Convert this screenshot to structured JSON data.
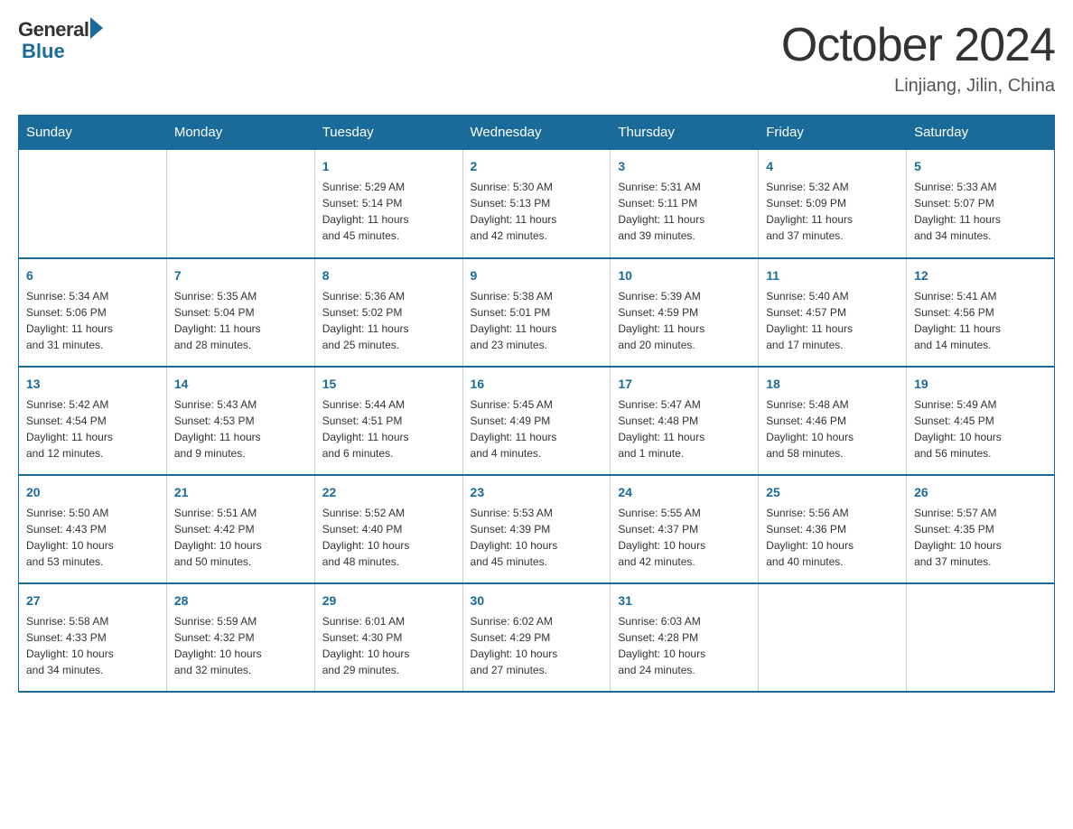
{
  "logo": {
    "general": "General",
    "blue": "Blue"
  },
  "title": "October 2024",
  "location": "Linjiang, Jilin, China",
  "days_of_week": [
    "Sunday",
    "Monday",
    "Tuesday",
    "Wednesday",
    "Thursday",
    "Friday",
    "Saturday"
  ],
  "weeks": [
    [
      {
        "day": "",
        "info": ""
      },
      {
        "day": "",
        "info": ""
      },
      {
        "day": "1",
        "info": "Sunrise: 5:29 AM\nSunset: 5:14 PM\nDaylight: 11 hours\nand 45 minutes."
      },
      {
        "day": "2",
        "info": "Sunrise: 5:30 AM\nSunset: 5:13 PM\nDaylight: 11 hours\nand 42 minutes."
      },
      {
        "day": "3",
        "info": "Sunrise: 5:31 AM\nSunset: 5:11 PM\nDaylight: 11 hours\nand 39 minutes."
      },
      {
        "day": "4",
        "info": "Sunrise: 5:32 AM\nSunset: 5:09 PM\nDaylight: 11 hours\nand 37 minutes."
      },
      {
        "day": "5",
        "info": "Sunrise: 5:33 AM\nSunset: 5:07 PM\nDaylight: 11 hours\nand 34 minutes."
      }
    ],
    [
      {
        "day": "6",
        "info": "Sunrise: 5:34 AM\nSunset: 5:06 PM\nDaylight: 11 hours\nand 31 minutes."
      },
      {
        "day": "7",
        "info": "Sunrise: 5:35 AM\nSunset: 5:04 PM\nDaylight: 11 hours\nand 28 minutes."
      },
      {
        "day": "8",
        "info": "Sunrise: 5:36 AM\nSunset: 5:02 PM\nDaylight: 11 hours\nand 25 minutes."
      },
      {
        "day": "9",
        "info": "Sunrise: 5:38 AM\nSunset: 5:01 PM\nDaylight: 11 hours\nand 23 minutes."
      },
      {
        "day": "10",
        "info": "Sunrise: 5:39 AM\nSunset: 4:59 PM\nDaylight: 11 hours\nand 20 minutes."
      },
      {
        "day": "11",
        "info": "Sunrise: 5:40 AM\nSunset: 4:57 PM\nDaylight: 11 hours\nand 17 minutes."
      },
      {
        "day": "12",
        "info": "Sunrise: 5:41 AM\nSunset: 4:56 PM\nDaylight: 11 hours\nand 14 minutes."
      }
    ],
    [
      {
        "day": "13",
        "info": "Sunrise: 5:42 AM\nSunset: 4:54 PM\nDaylight: 11 hours\nand 12 minutes."
      },
      {
        "day": "14",
        "info": "Sunrise: 5:43 AM\nSunset: 4:53 PM\nDaylight: 11 hours\nand 9 minutes."
      },
      {
        "day": "15",
        "info": "Sunrise: 5:44 AM\nSunset: 4:51 PM\nDaylight: 11 hours\nand 6 minutes."
      },
      {
        "day": "16",
        "info": "Sunrise: 5:45 AM\nSunset: 4:49 PM\nDaylight: 11 hours\nand 4 minutes."
      },
      {
        "day": "17",
        "info": "Sunrise: 5:47 AM\nSunset: 4:48 PM\nDaylight: 11 hours\nand 1 minute."
      },
      {
        "day": "18",
        "info": "Sunrise: 5:48 AM\nSunset: 4:46 PM\nDaylight: 10 hours\nand 58 minutes."
      },
      {
        "day": "19",
        "info": "Sunrise: 5:49 AM\nSunset: 4:45 PM\nDaylight: 10 hours\nand 56 minutes."
      }
    ],
    [
      {
        "day": "20",
        "info": "Sunrise: 5:50 AM\nSunset: 4:43 PM\nDaylight: 10 hours\nand 53 minutes."
      },
      {
        "day": "21",
        "info": "Sunrise: 5:51 AM\nSunset: 4:42 PM\nDaylight: 10 hours\nand 50 minutes."
      },
      {
        "day": "22",
        "info": "Sunrise: 5:52 AM\nSunset: 4:40 PM\nDaylight: 10 hours\nand 48 minutes."
      },
      {
        "day": "23",
        "info": "Sunrise: 5:53 AM\nSunset: 4:39 PM\nDaylight: 10 hours\nand 45 minutes."
      },
      {
        "day": "24",
        "info": "Sunrise: 5:55 AM\nSunset: 4:37 PM\nDaylight: 10 hours\nand 42 minutes."
      },
      {
        "day": "25",
        "info": "Sunrise: 5:56 AM\nSunset: 4:36 PM\nDaylight: 10 hours\nand 40 minutes."
      },
      {
        "day": "26",
        "info": "Sunrise: 5:57 AM\nSunset: 4:35 PM\nDaylight: 10 hours\nand 37 minutes."
      }
    ],
    [
      {
        "day": "27",
        "info": "Sunrise: 5:58 AM\nSunset: 4:33 PM\nDaylight: 10 hours\nand 34 minutes."
      },
      {
        "day": "28",
        "info": "Sunrise: 5:59 AM\nSunset: 4:32 PM\nDaylight: 10 hours\nand 32 minutes."
      },
      {
        "day": "29",
        "info": "Sunrise: 6:01 AM\nSunset: 4:30 PM\nDaylight: 10 hours\nand 29 minutes."
      },
      {
        "day": "30",
        "info": "Sunrise: 6:02 AM\nSunset: 4:29 PM\nDaylight: 10 hours\nand 27 minutes."
      },
      {
        "day": "31",
        "info": "Sunrise: 6:03 AM\nSunset: 4:28 PM\nDaylight: 10 hours\nand 24 minutes."
      },
      {
        "day": "",
        "info": ""
      },
      {
        "day": "",
        "info": ""
      }
    ]
  ]
}
